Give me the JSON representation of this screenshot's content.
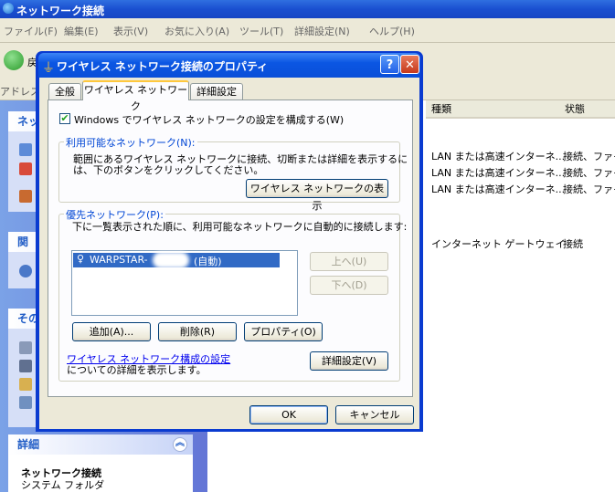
{
  "explorer": {
    "title": "ネットワーク接続",
    "menu": [
      "ファイル(F)",
      "編集(E)",
      "表示(V)",
      "お気に入り(A)",
      "ツール(T)",
      "詳細設定(N)",
      "ヘルプ(H)"
    ],
    "back_label": "戻",
    "address_label": "アドレス",
    "left_panel": {
      "box1_header": "ネッ",
      "box2_header": "関",
      "box3_header": "その",
      "details_header": "詳細",
      "details_name": "ネットワーク接続",
      "details_type": "システム フォルダ"
    },
    "columns": [
      "種類",
      "状態"
    ],
    "rows": [
      {
        "type": "LAN または高速インターネ...",
        "status": "接続、ファイ"
      },
      {
        "type": "LAN または高速インターネ...",
        "status": "接続、ファイ"
      },
      {
        "type": "LAN または高速インターネ...",
        "status": "接続、ファイ"
      },
      {
        "type": "インターネット ゲートウェイ",
        "status": "接続"
      }
    ]
  },
  "dialog": {
    "title": "ワイヤレス ネットワーク接続のプロパティ",
    "help_label": "?",
    "close_label": "✕",
    "tabs": [
      "全般",
      "ワイヤレス ネットワーク",
      "詳細設定"
    ],
    "use_windows_label": "Windows でワイヤレス ネットワークの設定を構成する(W)",
    "use_windows_checked": true,
    "available": {
      "label": "利用可能なネットワーク(N):",
      "desc_line1": "範囲にあるワイヤレス ネットワークに接続、切断または詳細を表示するに",
      "desc_line2": "は、下のボタンをクリックしてください。",
      "view_button": "ワイヤレス ネットワークの表示"
    },
    "preferred": {
      "label": "優先ネットワーク(P):",
      "desc": "下に一覧表示された順に、利用可能なネットワークに自動的に接続します:",
      "items": [
        {
          "name": "WARPSTAR-",
          "mode": "(自動)"
        }
      ],
      "up_button": "上へ(U)",
      "down_button": "下へ(D)",
      "add_button": "追加(A)...",
      "remove_button": "削除(R)",
      "properties_button": "プロパティ(O)",
      "link_text": "ワイヤレス ネットワーク構成の設定",
      "link_suffix": "についての詳細を表示します。",
      "advanced_button": "詳細設定(V)"
    },
    "ok_button": "OK",
    "cancel_button": "キャンセル"
  },
  "colors": {
    "title_blue": "#0b56e3",
    "selection": "#316ac5",
    "group_label": "#0046d5"
  }
}
